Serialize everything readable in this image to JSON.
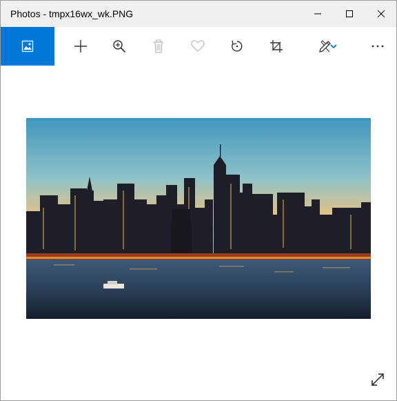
{
  "window": {
    "title": "Photos - tmpx16wx_wk.PNG",
    "controls": [
      "minimize-icon",
      "maximize-icon",
      "close-icon"
    ]
  },
  "toolbar": {
    "items": [
      {
        "name": "see-all-photos",
        "icon": "image-icon",
        "active": true
      },
      {
        "name": "add-to",
        "icon": "plus-icon"
      },
      {
        "name": "zoom",
        "icon": "zoom-in-icon"
      },
      {
        "name": "delete",
        "icon": "trash-icon",
        "disabled": true
      },
      {
        "name": "favorite",
        "icon": "heart-icon",
        "disabled": true
      },
      {
        "name": "rotate",
        "icon": "rotate-icon"
      },
      {
        "name": "crop",
        "icon": "crop-icon"
      },
      {
        "name": "edit-create",
        "icon": "draw-icon",
        "has_dropdown": true
      },
      {
        "name": "more",
        "icon": "more-icon"
      }
    ]
  },
  "photo": {
    "subject": "city skyline at dusk",
    "colors": {
      "accent": "#0078d7",
      "sky_top": "#4fa7c8",
      "sky_bottom": "#f6a23a",
      "water": "#2a3c4e"
    }
  },
  "fullscreen": {
    "icon": "expand-icon"
  }
}
